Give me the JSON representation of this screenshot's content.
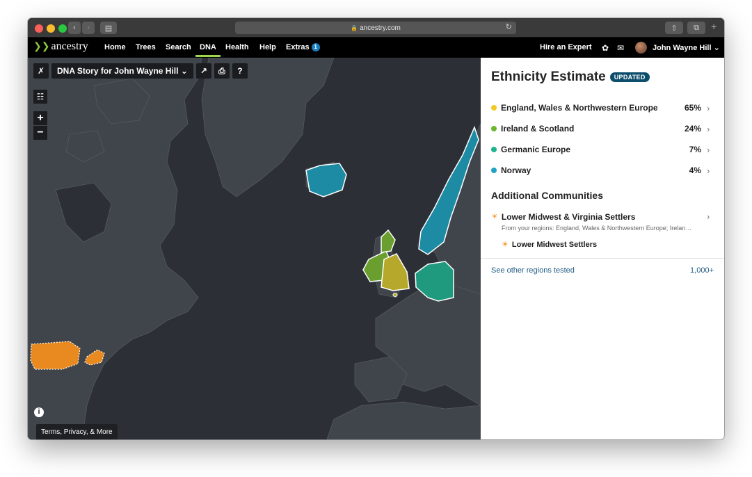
{
  "browser": {
    "url": "ancestry.com"
  },
  "nav": {
    "logo": "ancestry",
    "items": [
      "Home",
      "Trees",
      "Search",
      "DNA",
      "Health",
      "Help",
      "Extras"
    ],
    "extras_badge": "1",
    "hire": "Hire an Expert",
    "user": "John Wayne Hill"
  },
  "map": {
    "story_title": "DNA Story for John Wayne Hill",
    "terms": "Terms, Privacy, & More",
    "region_colors": {
      "england": "#b5a82b",
      "ireland": "#6a9e2e",
      "germanic": "#1f9a7f",
      "norway": "#1c8ba3",
      "settlers": "#e88a1f"
    }
  },
  "panel": {
    "title": "Ethnicity Estimate",
    "updated_badge": "UPDATED",
    "ethnicities": [
      {
        "name": "England, Wales & Northwestern Europe",
        "pct": "65%",
        "color": "#f2c822"
      },
      {
        "name": "Ireland & Scotland",
        "pct": "24%",
        "color": "#6cb82c"
      },
      {
        "name": "Germanic Europe",
        "pct": "7%",
        "color": "#1eb48d"
      },
      {
        "name": "Norway",
        "pct": "4%",
        "color": "#1ea3c2"
      }
    ],
    "communities_title": "Additional Communities",
    "community": {
      "name": "Lower Midwest & Virginia Settlers",
      "sub": "From your regions: England, Wales & Northwestern Europe; Irelan…",
      "child": "Lower Midwest Settlers"
    },
    "other_regions": "See other regions tested",
    "other_count": "1,000+"
  }
}
